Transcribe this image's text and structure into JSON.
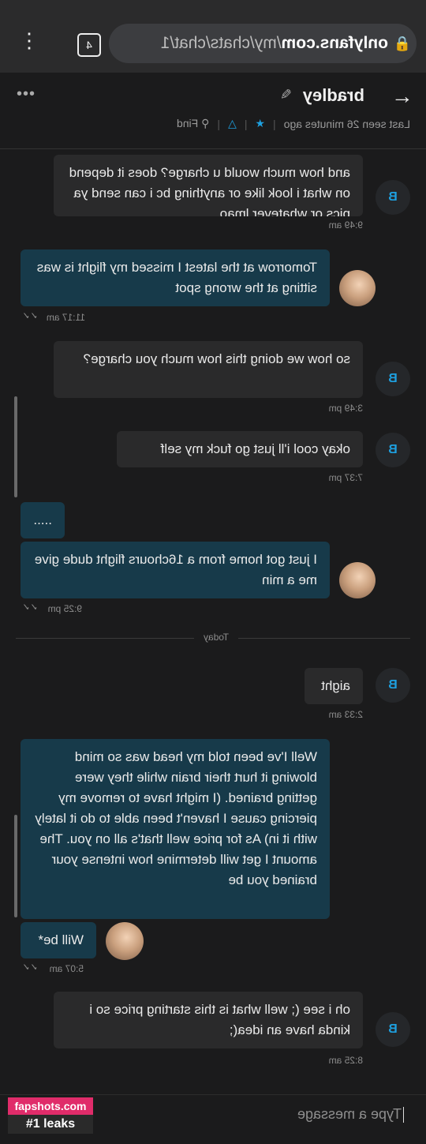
{
  "browser": {
    "url_domain": "onlyfans.com",
    "url_path": "/my/chats/chat/1",
    "tab_count": "4"
  },
  "chat": {
    "name": "bradley",
    "last_seen": "Last seen 26 minutes ago",
    "find": "Find",
    "today_label": "Today",
    "input_placeholder": "Type a message"
  },
  "messages": [
    {
      "from": "B",
      "text": "and how much would u charge? does it depend on what i look like or anything bc i can send ya pics or whatever lmao",
      "time": "9:49 am"
    },
    {
      "from": "me",
      "text": "Tomorrow at the latest I missed my flight is was sitting at the wrong spot",
      "time": "11:17 am"
    },
    {
      "from": "B",
      "text": "so how we doing this how much you charge?",
      "time": "3:49 pm"
    },
    {
      "from": "B",
      "text": "okay cool i'll just go fuck my self",
      "time": "7:37 pm"
    },
    {
      "from": "me",
      "text": ".....",
      "time": ""
    },
    {
      "from": "me",
      "text": "I just got home from a 16chours flight dude give me a min",
      "time": "9:25 pm"
    },
    {
      "from": "B",
      "text": "aight",
      "time": "2:33 am"
    },
    {
      "from": "me",
      "text": "Well I've been told my head was so mind blowing it hurt their brain while they were getting brained. (I might have to remove my piercing cause I haven't been able to do it lately with it in) As for price well that's all on you. The amount I get will determine how intense your brained you be",
      "time": ""
    },
    {
      "from": "me",
      "text": "Will be*",
      "time": "5:07 am"
    },
    {
      "from": "B",
      "text": "oh i see (; well what is this starting price so i kinda have an idea(;",
      "time": "8:25 am"
    }
  ],
  "watermark": {
    "line1": "fapshots.com",
    "line2": "#1 leaks"
  },
  "colors": {
    "background": "#1b1b1c",
    "incoming": "#2a2a2b",
    "outgoing": "#173a4a",
    "accent": "#1ea0e0"
  }
}
